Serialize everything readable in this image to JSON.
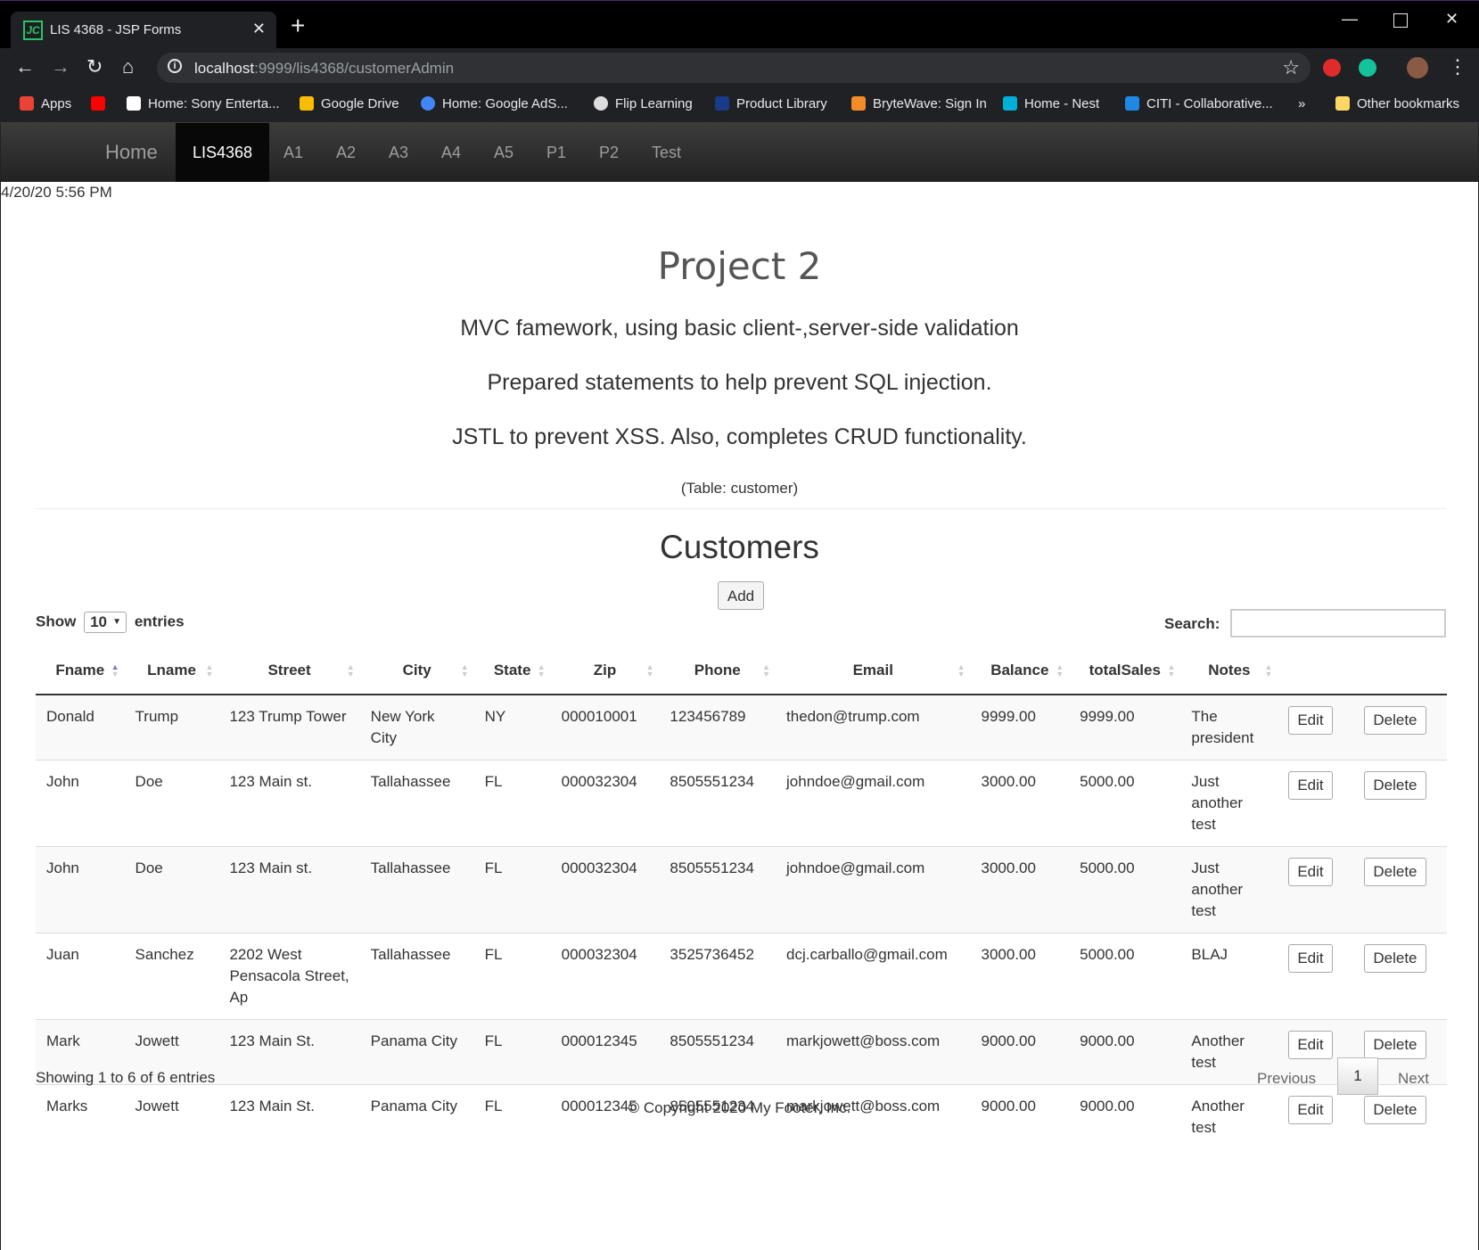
{
  "browser": {
    "tab_title": "LIS 4368 - JSP Forms",
    "tab_favicon": "JC",
    "url_host": "localhost",
    "url_rest": ":9999/lis4368/customerAdmin",
    "bookmarks": [
      {
        "label": "Apps",
        "color": "#ea4335"
      },
      {
        "label": "",
        "color": "#ff0000"
      },
      {
        "label": "Home: Sony Enterta...",
        "color": "#ffffff"
      },
      {
        "label": "Google Drive",
        "color": "#fbbc04"
      },
      {
        "label": "Home: Google AdS...",
        "color": "#4285f4"
      },
      {
        "label": "Flip Learning",
        "color": "#dddddd"
      },
      {
        "label": "Product Library",
        "color": "#1a3a8a"
      },
      {
        "label": "BryteWave: Sign In",
        "color": "#f28c28"
      },
      {
        "label": "Home - Nest",
        "color": "#00afd8"
      },
      {
        "label": "CITI - Collaborative...",
        "color": "#1e88e5"
      }
    ],
    "more_bookmarks": "»",
    "other_bookmarks": "Other bookmarks"
  },
  "nav": {
    "brand": "Home",
    "items": [
      "LIS4368",
      "A1",
      "A2",
      "A3",
      "A4",
      "A5",
      "P1",
      "P2",
      "Test"
    ]
  },
  "datetime": "4/20/20 5:56 PM",
  "header": {
    "title": "Project 2",
    "line1": "MVC famework, using basic client-,server-side validation",
    "line2": "Prepared statements to help prevent SQL injection.",
    "line3": "JSTL to prevent XSS. Also, completes CRUD functionality.",
    "table_name": "(Table: customer)"
  },
  "customers_heading": "Customers",
  "add_label": "Add",
  "show": {
    "prefix": "Show",
    "value": "10",
    "suffix": "entries"
  },
  "search_label": "Search:",
  "table": {
    "columns": [
      "Fname",
      "Lname",
      "Street",
      "City",
      "State",
      "Zip",
      "Phone",
      "Email",
      "Balance",
      "totalSales",
      "Notes"
    ],
    "edit_label": "Edit",
    "delete_label": "Delete",
    "rows": [
      [
        "Donald",
        "Trump",
        "123 Trump Tower",
        "New York City",
        "NY",
        "000010001",
        "123456789",
        "thedon@trump.com",
        "9999.00",
        "9999.00",
        "The president"
      ],
      [
        "John",
        "Doe",
        "123 Main st.",
        "Tallahassee",
        "FL",
        "000032304",
        "8505551234",
        "johndoe@gmail.com",
        "3000.00",
        "5000.00",
        "Just another test"
      ],
      [
        "John",
        "Doe",
        "123 Main st.",
        "Tallahassee",
        "FL",
        "000032304",
        "8505551234",
        "johndoe@gmail.com",
        "3000.00",
        "5000.00",
        "Just another test"
      ],
      [
        "Juan",
        "Sanchez",
        "2202 West Pensacola Street, Ap",
        "Tallahassee",
        "FL",
        "000032304",
        "3525736452",
        "dcj.carballo@gmail.com",
        "3000.00",
        "5000.00",
        "BLAJ"
      ],
      [
        "Mark",
        "Jowett",
        "123 Main St.",
        "Panama City",
        "FL",
        "000012345",
        "8505551234",
        "markjowett@boss.com",
        "9000.00",
        "9000.00",
        "Another test"
      ],
      [
        "Marks",
        "Jowett",
        "123 Main St.",
        "Panama City",
        "FL",
        "000012345",
        "8505551234",
        "markjowett@boss.com",
        "9000.00",
        "9000.00",
        "Another test"
      ]
    ]
  },
  "pagination": {
    "info": "Showing 1 to 6 of 6 entries",
    "previous": "Previous",
    "current": "1",
    "next": "Next"
  },
  "footer": "© Copyright 2020 My Footer, Inc."
}
